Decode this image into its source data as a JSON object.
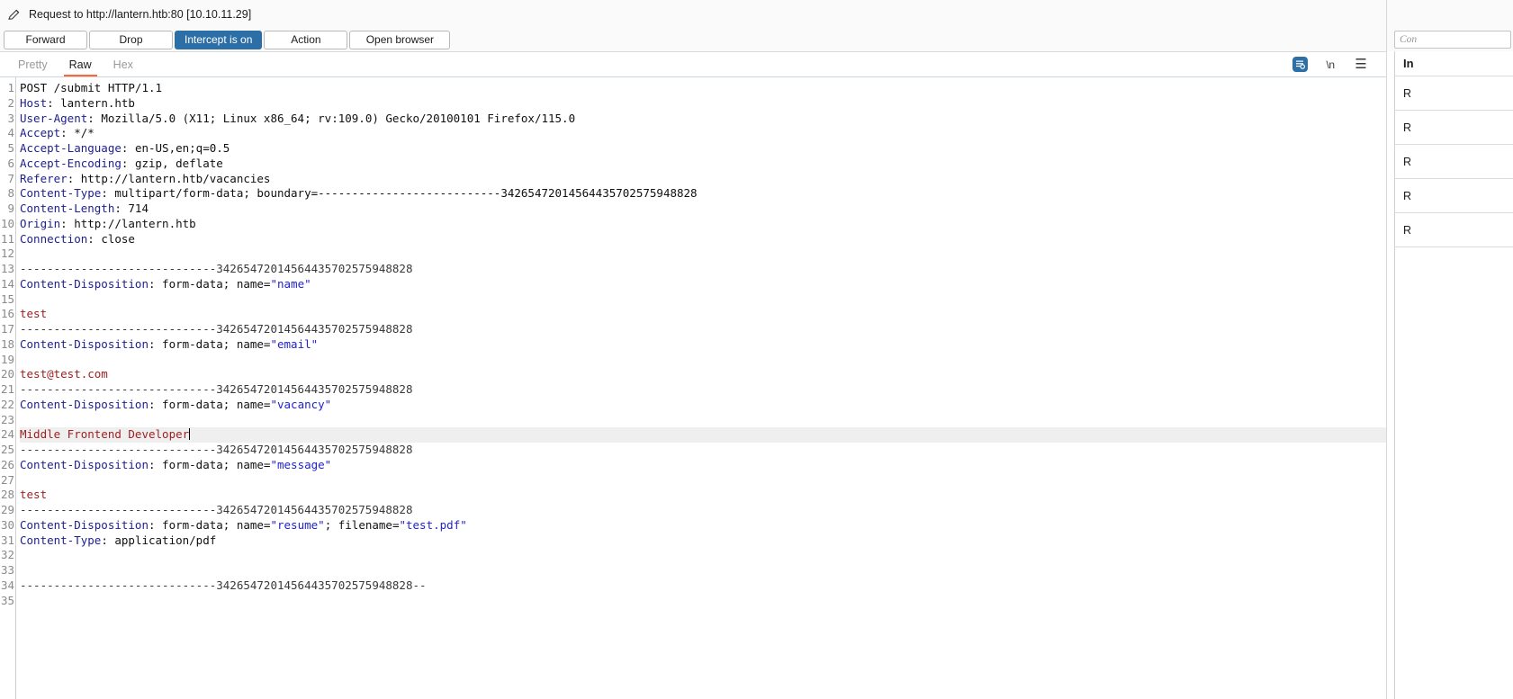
{
  "titlebar": {
    "icon": "pencil-icon",
    "text": "Request to http://lantern.htb:80  [10.10.11.29]"
  },
  "buttons": [
    {
      "label": "Forward",
      "primary": false
    },
    {
      "label": "Drop",
      "primary": false
    },
    {
      "label": "Intercept is on",
      "primary": true
    },
    {
      "label": "Action",
      "primary": false
    },
    {
      "label": "Open browser",
      "primary": false
    }
  ],
  "tabs": [
    {
      "label": "Pretty",
      "active": false
    },
    {
      "label": "Raw",
      "active": true
    },
    {
      "label": "Hex",
      "active": false
    }
  ],
  "tab_icons": [
    {
      "name": "document-format-icon",
      "glyph": ""
    },
    {
      "name": "newline-toggle-icon",
      "glyph": "\\n"
    },
    {
      "name": "menu-icon",
      "glyph": "☰"
    }
  ],
  "accent_colors": {
    "primary_button": "#2c6fa6",
    "active_tab_underline": "#ff6633",
    "header_name": "#20208f",
    "quoted_string": "#2222cc",
    "body_value": "#9e2020",
    "highlight_row": "#efefef"
  },
  "editor": {
    "total_lines": 35,
    "highlighted_line": 24,
    "caret_line": 24,
    "boundary": "---------------------------342654720145644357025759488 28",
    "lines": [
      {
        "n": 1,
        "segments": [
          {
            "t": "POST /submit HTTP/1.1",
            "c": "k-val"
          }
        ]
      },
      {
        "n": 2,
        "segments": [
          {
            "t": "Host",
            "c": "k-hdr"
          },
          {
            "t": ": lantern.htb",
            "c": "k-val"
          }
        ]
      },
      {
        "n": 3,
        "segments": [
          {
            "t": "User-Agent",
            "c": "k-hdr"
          },
          {
            "t": ": Mozilla/5.0 (X11; Linux x86_64; rv:109.0) Gecko/20100101 Firefox/115.0",
            "c": "k-val"
          }
        ]
      },
      {
        "n": 4,
        "segments": [
          {
            "t": "Accept",
            "c": "k-hdr"
          },
          {
            "t": ": */*",
            "c": "k-val"
          }
        ]
      },
      {
        "n": 5,
        "segments": [
          {
            "t": "Accept-Language",
            "c": "k-hdr"
          },
          {
            "t": ": en-US,en;q=0.5",
            "c": "k-val"
          }
        ]
      },
      {
        "n": 6,
        "segments": [
          {
            "t": "Accept-Encoding",
            "c": "k-hdr"
          },
          {
            "t": ": gzip, deflate",
            "c": "k-val"
          }
        ]
      },
      {
        "n": 7,
        "segments": [
          {
            "t": "Referer",
            "c": "k-hdr"
          },
          {
            "t": ": http://lantern.htb/vacancies",
            "c": "k-val"
          }
        ]
      },
      {
        "n": 8,
        "segments": [
          {
            "t": "Content-Type",
            "c": "k-hdr"
          },
          {
            "t": ": multipart/form-data; boundary=---------------------------342654720145644357025759 48828",
            "c": "k-val"
          }
        ]
      },
      {
        "n": 9,
        "segments": [
          {
            "t": "Content-Length",
            "c": "k-hdr"
          },
          {
            "t": ": 714",
            "c": "k-val"
          }
        ]
      },
      {
        "n": 10,
        "segments": [
          {
            "t": "Origin",
            "c": "k-hdr"
          },
          {
            "t": ": http://lantern.htb",
            "c": "k-val"
          }
        ]
      },
      {
        "n": 11,
        "segments": [
          {
            "t": "Connection",
            "c": "k-hdr"
          },
          {
            "t": ": close",
            "c": "k-val"
          }
        ]
      },
      {
        "n": 12,
        "segments": []
      },
      {
        "n": 13,
        "segments": [
          {
            "t": "-----------------------------342654720145644357025759488 28",
            "c": "k-dash"
          }
        ]
      },
      {
        "n": 14,
        "segments": [
          {
            "t": "Content-Disposition",
            "c": "k-hdr"
          },
          {
            "t": ": form-data; name=",
            "c": "k-val"
          },
          {
            "t": "\"name\"",
            "c": "k-str"
          }
        ]
      },
      {
        "n": 15,
        "segments": []
      },
      {
        "n": 16,
        "segments": [
          {
            "t": "test",
            "c": "k-body"
          }
        ]
      },
      {
        "n": 17,
        "segments": [
          {
            "t": "-----------------------------342654720145644357025759488 28",
            "c": "k-dash"
          }
        ]
      },
      {
        "n": 18,
        "segments": [
          {
            "t": "Content-Disposition",
            "c": "k-hdr"
          },
          {
            "t": ": form-data; name=",
            "c": "k-val"
          },
          {
            "t": "\"email\"",
            "c": "k-str"
          }
        ]
      },
      {
        "n": 19,
        "segments": []
      },
      {
        "n": 20,
        "segments": [
          {
            "t": "test@test.com",
            "c": "k-body"
          }
        ]
      },
      {
        "n": 21,
        "segments": [
          {
            "t": "-----------------------------342654720145644357025759488 28",
            "c": "k-dash"
          }
        ]
      },
      {
        "n": 22,
        "segments": [
          {
            "t": "Content-Disposition",
            "c": "k-hdr"
          },
          {
            "t": ": form-data; name=",
            "c": "k-val"
          },
          {
            "t": "\"vacancy\"",
            "c": "k-str"
          }
        ]
      },
      {
        "n": 23,
        "segments": []
      },
      {
        "n": 24,
        "segments": [
          {
            "t": "Middle Frontend Developer",
            "c": "k-body"
          }
        ],
        "highlight": true,
        "caret": true
      },
      {
        "n": 25,
        "segments": [
          {
            "t": "-----------------------------342654720145644357025759488 28",
            "c": "k-dash"
          }
        ]
      },
      {
        "n": 26,
        "segments": [
          {
            "t": "Content-Disposition",
            "c": "k-hdr"
          },
          {
            "t": ": form-data; name=",
            "c": "k-val"
          },
          {
            "t": "\"message\"",
            "c": "k-str"
          }
        ]
      },
      {
        "n": 27,
        "segments": []
      },
      {
        "n": 28,
        "segments": [
          {
            "t": "test",
            "c": "k-body"
          }
        ]
      },
      {
        "n": 29,
        "segments": [
          {
            "t": "-----------------------------342654720145644357025759488 28",
            "c": "k-dash"
          }
        ]
      },
      {
        "n": 30,
        "segments": [
          {
            "t": "Content-Disposition",
            "c": "k-hdr"
          },
          {
            "t": ": form-data; name=",
            "c": "k-val"
          },
          {
            "t": "\"resume\"",
            "c": "k-str"
          },
          {
            "t": "; filename=",
            "c": "k-val"
          },
          {
            "t": "\"test.pdf\"",
            "c": "k-str"
          }
        ]
      },
      {
        "n": 31,
        "segments": [
          {
            "t": "Content-Type",
            "c": "k-hdr"
          },
          {
            "t": ": application/pdf",
            "c": "k-val"
          }
        ]
      },
      {
        "n": 32,
        "segments": []
      },
      {
        "n": 33,
        "segments": []
      },
      {
        "n": 34,
        "segments": [
          {
            "t": "-----------------------------342654720145644357025759488 28--",
            "c": "k-dash"
          }
        ]
      },
      {
        "n": 35,
        "segments": []
      }
    ]
  },
  "right": {
    "search_placeholder": "Con",
    "panel_title": "In",
    "rows": [
      {
        "label": "R"
      },
      {
        "label": "R"
      },
      {
        "label": "R"
      },
      {
        "label": "R"
      },
      {
        "label": "R"
      }
    ]
  }
}
